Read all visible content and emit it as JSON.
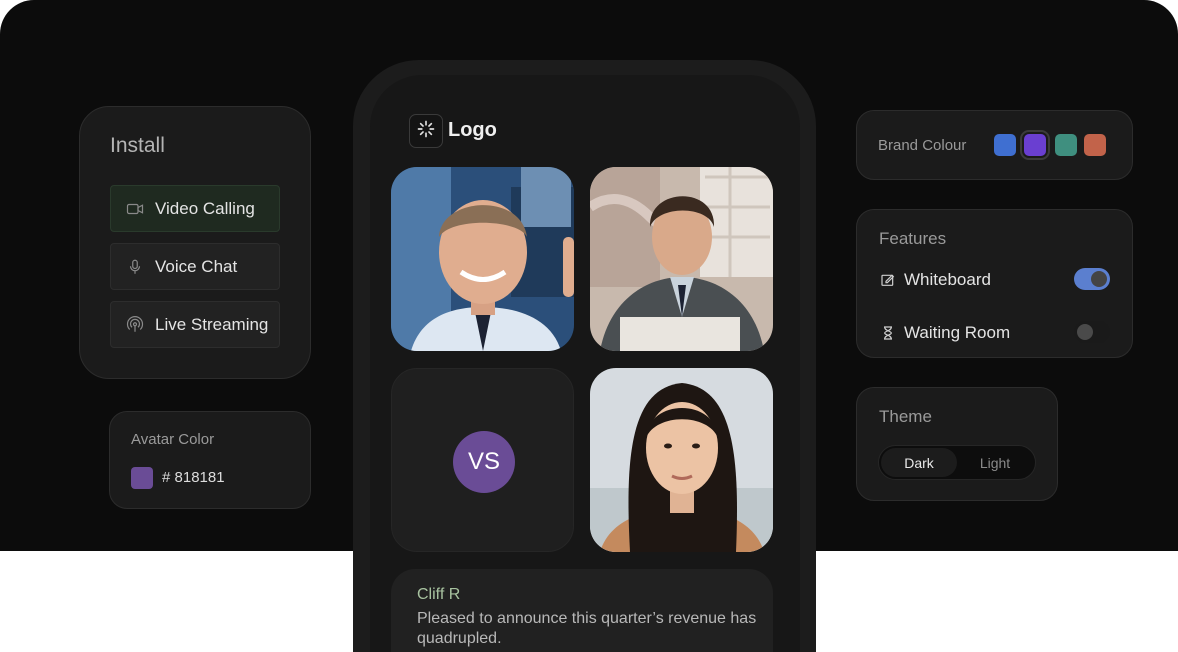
{
  "install": {
    "title": "Install",
    "items": [
      {
        "label": "Video Calling",
        "icon": "video-icon"
      },
      {
        "label": "Voice Chat",
        "icon": "microphone-icon"
      },
      {
        "label": "Live Streaming",
        "icon": "broadcast-icon"
      }
    ]
  },
  "avatar_color": {
    "title": "Avatar Color",
    "value": "# 818181",
    "swatch": "#6a4c96"
  },
  "app": {
    "logo_text": "Logo",
    "logo_icon": "spinner-icon"
  },
  "participants": [
    {
      "type": "video"
    },
    {
      "type": "video"
    },
    {
      "type": "avatar",
      "initials": "VS",
      "color": "#6a4c96"
    },
    {
      "type": "video"
    }
  ],
  "message": {
    "sender": "Cliff R",
    "text": "Pleased to announce this quarter’s revenue has quadrupled."
  },
  "brand_colour": {
    "title": "Brand Colour",
    "swatches": [
      "#3f6fd1",
      "#6a3fd1",
      "#3f8f7f",
      "#c2634a"
    ],
    "selected_index": 1
  },
  "features": {
    "title": "Features",
    "items": [
      {
        "label": "Whiteboard",
        "icon": "whiteboard-icon",
        "enabled": true
      },
      {
        "label": "Waiting Room",
        "icon": "hourglass-icon",
        "enabled": false
      }
    ]
  },
  "theme": {
    "title": "Theme",
    "options": [
      "Dark",
      "Light"
    ],
    "selected": "Dark"
  }
}
